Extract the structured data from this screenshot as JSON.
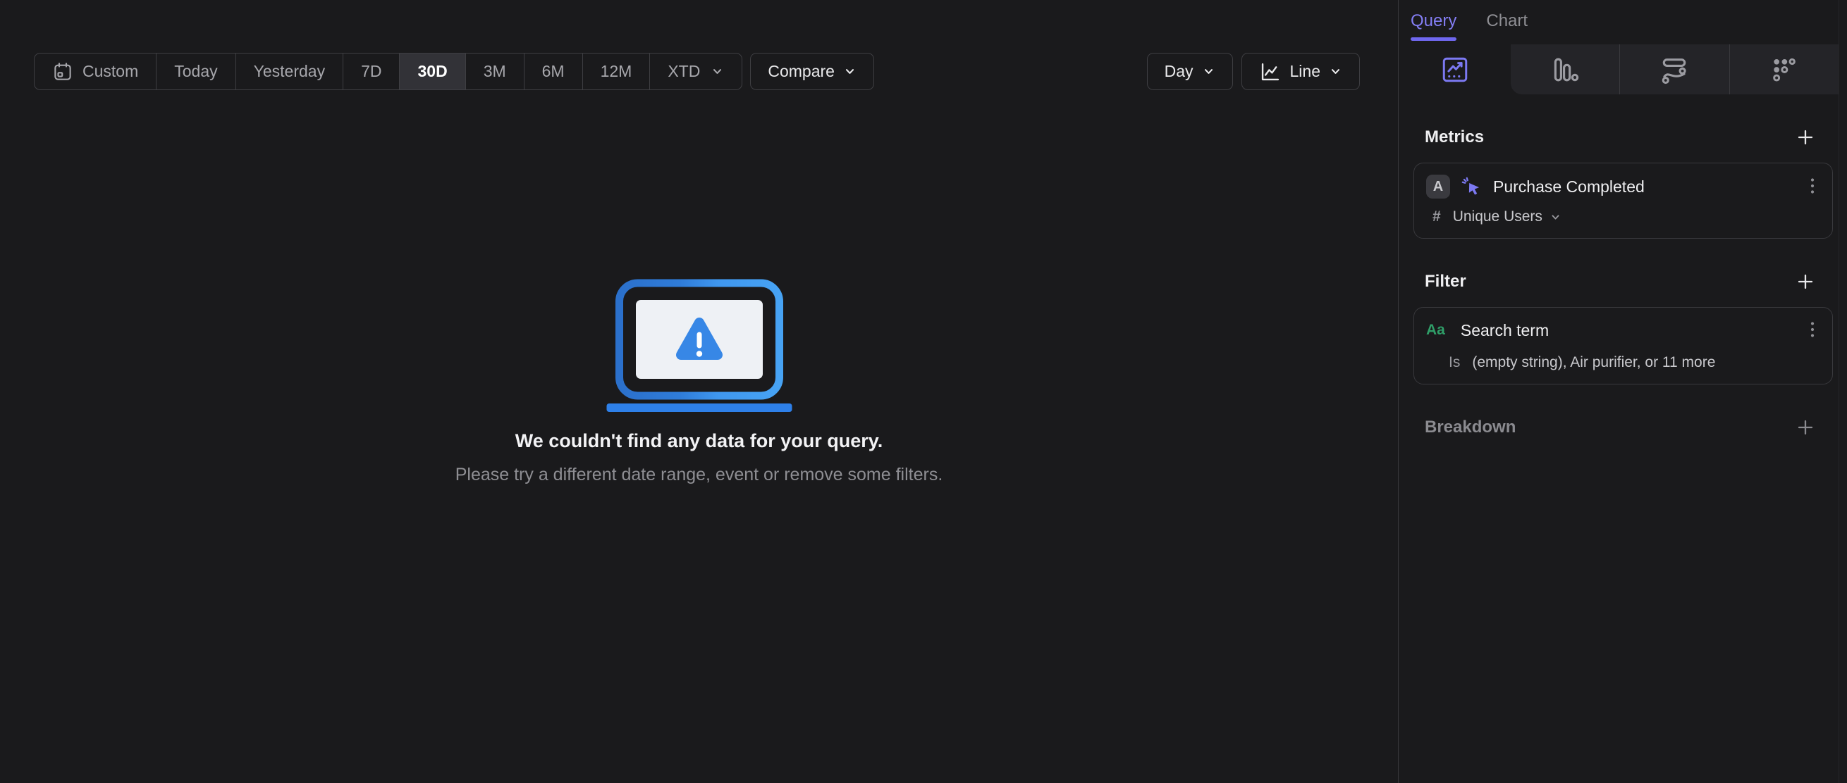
{
  "toolbar": {
    "date_ranges": [
      {
        "label": "Custom"
      },
      {
        "label": "Today"
      },
      {
        "label": "Yesterday"
      },
      {
        "label": "7D"
      },
      {
        "label": "30D"
      },
      {
        "label": "3M"
      },
      {
        "label": "6M"
      },
      {
        "label": "12M"
      },
      {
        "label": "XTD"
      }
    ],
    "selected_range": "30D",
    "compare_label": "Compare",
    "granularity_label": "Day",
    "chart_type_label": "Line"
  },
  "empty_state": {
    "title": "We couldn't find any data for your query.",
    "subtitle": "Please try a different date range, event or remove some filters."
  },
  "panel": {
    "tabs": [
      {
        "label": "Query"
      },
      {
        "label": "Chart"
      }
    ],
    "active_tab": "Query",
    "chart_type_tabs": [
      {
        "icon": "insights-line-icon",
        "selected": true
      },
      {
        "icon": "bar-chart-icon",
        "selected": false
      },
      {
        "icon": "flows-icon",
        "selected": false
      },
      {
        "icon": "retention-icon",
        "selected": false
      }
    ],
    "metrics": {
      "heading": "Metrics",
      "event": {
        "letter": "A",
        "name": "Purchase Completed",
        "aggregation_prefix": "#",
        "aggregation": "Unique Users"
      }
    },
    "filter": {
      "heading": "Filter",
      "property": {
        "type_badge": "Aa",
        "name": "Search term",
        "operator": "Is",
        "values": "(empty string), Air purifier, or 11 more"
      }
    },
    "breakdown": {
      "heading": "Breakdown"
    }
  },
  "colors": {
    "accent_purple": "#837df2",
    "laptop_blue": "#3f97ef",
    "base_blue": "#2e80e9",
    "green_type": "#2f9e68",
    "selected_segment_bg": "#323237"
  }
}
